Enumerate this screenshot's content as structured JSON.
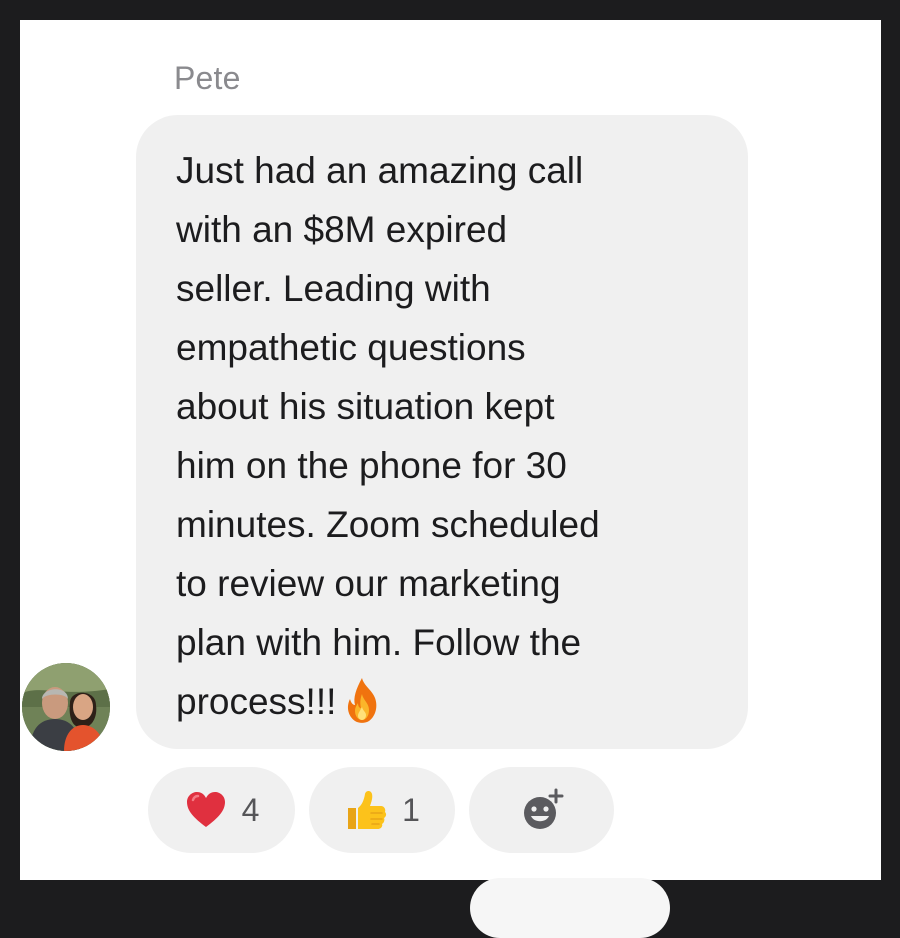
{
  "message": {
    "sender": "Pete",
    "lines": [
      "Just had an amazing call",
      "with an $8M expired",
      "seller. Leading with",
      "empathetic questions",
      "about his situation kept",
      "him on the phone for 30",
      "minutes. Zoom scheduled",
      "to review our marketing",
      "plan with him. Follow the",
      "process!!!"
    ],
    "emoji": "fire-icon"
  },
  "avatar": {
    "icon": "avatar-photo"
  },
  "reactions": [
    {
      "icon": "heart-icon",
      "count": "4"
    },
    {
      "icon": "thumbs-up-icon",
      "count": "1"
    },
    {
      "icon": "add-reaction-icon"
    }
  ],
  "colors": {
    "bubble": "#f0f0f0",
    "text": "#1c1c1e",
    "sender": "#8a8a8e",
    "frame": "#1c1c1e"
  }
}
